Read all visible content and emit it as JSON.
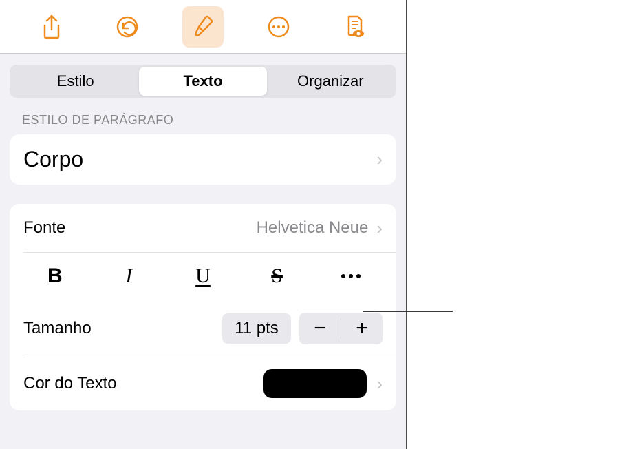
{
  "toolbar": {
    "icons": [
      "share",
      "undo",
      "format-brush",
      "more-circle",
      "document-view"
    ]
  },
  "tabs": {
    "items": [
      "Estilo",
      "Texto",
      "Organizar"
    ],
    "active_index": 1
  },
  "paragraph": {
    "header": "ESTILO DE PARÁGRAFO",
    "style_name": "Corpo"
  },
  "font": {
    "label": "Fonte",
    "value": "Helvetica Neue",
    "format_buttons": {
      "bold": "B",
      "italic": "I",
      "underline": "U",
      "strike": "S"
    }
  },
  "size": {
    "label": "Tamanho",
    "value": "11 pts"
  },
  "text_color": {
    "label": "Cor do Texto",
    "swatch": "#000000"
  }
}
